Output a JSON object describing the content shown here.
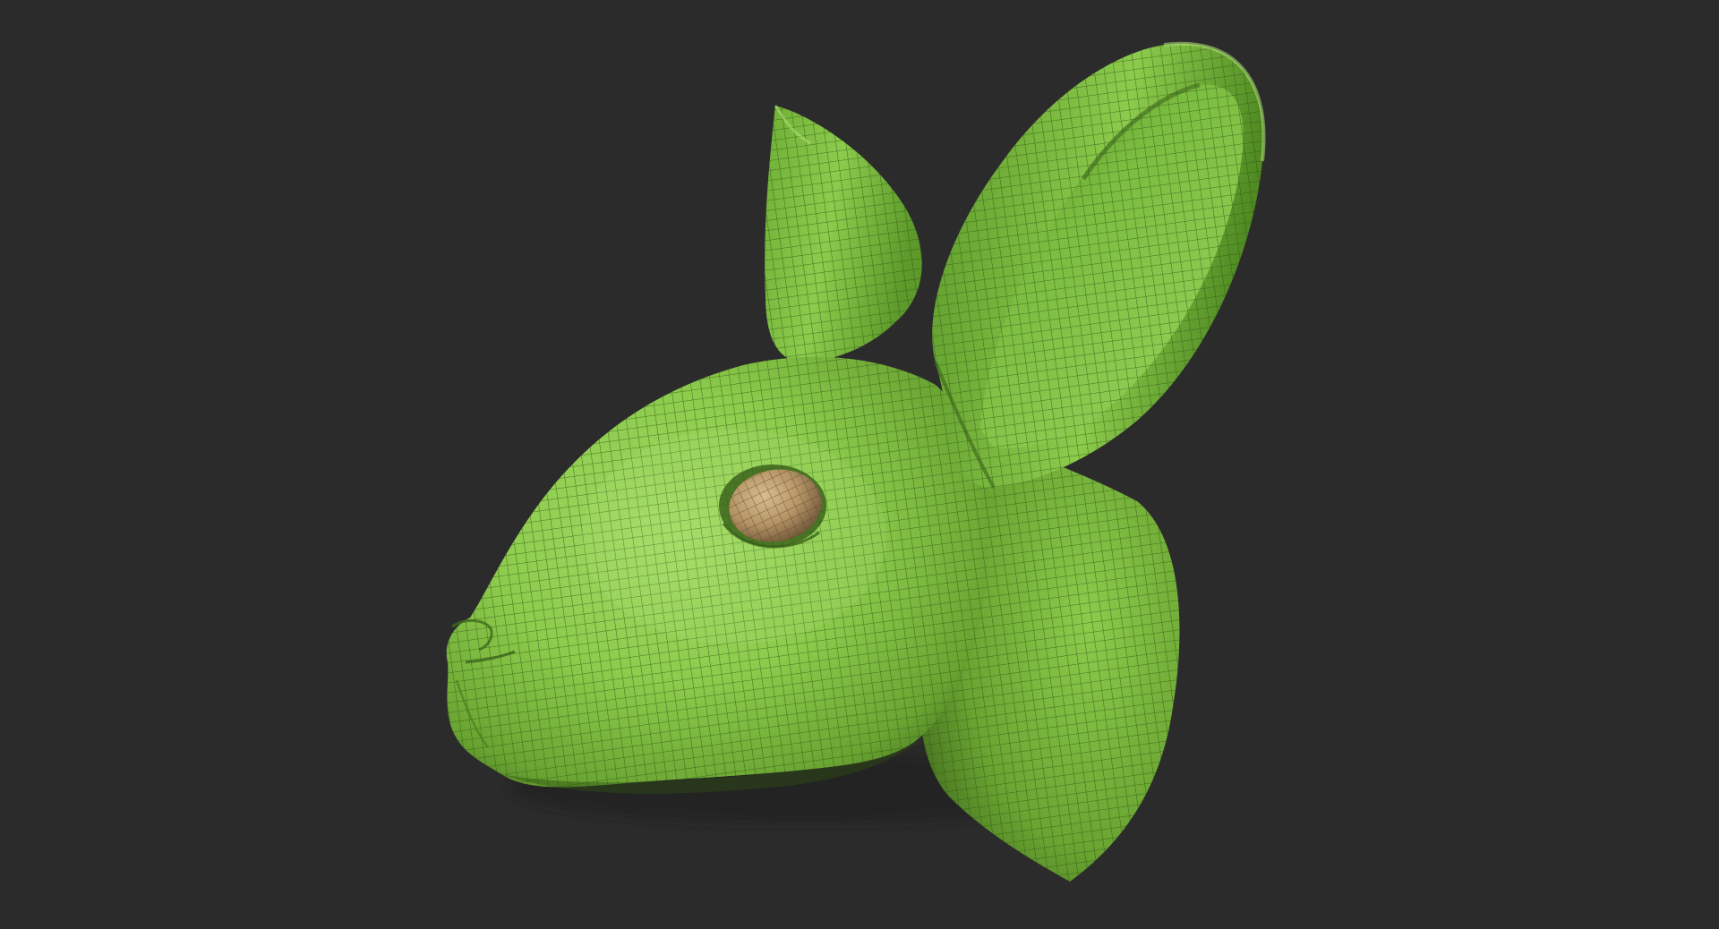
{
  "scene": {
    "background_color": "#2b2b2b",
    "model": {
      "subject": "rabbit-head",
      "material_color": "#7fbf3f",
      "highlight_color": "#a4dc66",
      "shadow_color": "#3f6a1c",
      "wire_color": "#2f5512",
      "eye_color": "#b59566",
      "eye_dark_color": "#6f5538",
      "eye_light_color": "#d9bd8f"
    }
  }
}
